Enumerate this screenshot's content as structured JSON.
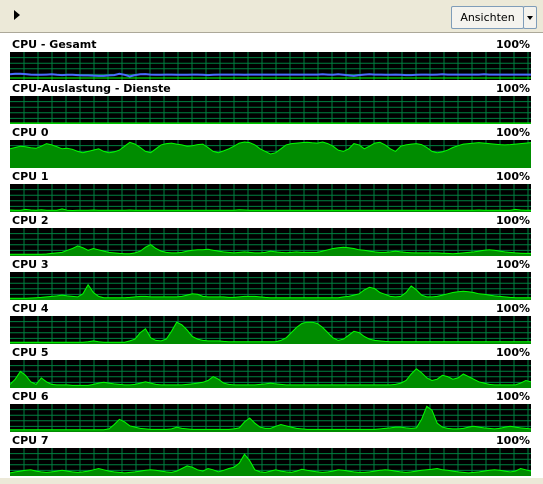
{
  "toolbar": {
    "views_label": "Ansichten"
  },
  "colors": {
    "graph_background": "#000000",
    "grid": "#008040",
    "line": "#00ff00",
    "fill": "#008c00",
    "total_line": "#4a6bff"
  },
  "scale_max_label": "100%",
  "graphs": [
    {
      "label": "CPU - Gesamt",
      "max_label": "100%",
      "values": [
        18,
        20,
        20,
        19,
        17,
        16,
        16,
        17,
        18,
        16,
        15,
        16,
        16,
        15,
        14,
        14,
        13,
        12,
        12,
        14,
        15,
        20,
        16,
        10,
        15,
        18,
        19,
        17,
        16,
        16,
        17,
        17,
        16,
        16,
        16,
        17,
        17,
        16,
        15,
        16,
        17,
        17,
        17,
        17,
        17,
        16,
        17,
        17,
        17,
        17,
        17,
        17,
        17,
        17,
        17,
        17,
        17,
        17,
        17,
        17,
        18,
        17,
        16,
        18,
        16,
        14,
        12,
        15,
        17,
        18,
        17,
        17,
        16,
        16,
        17,
        16,
        15,
        15,
        16,
        17,
        17,
        16,
        17,
        18,
        17,
        17,
        17,
        17,
        17,
        17,
        17,
        18,
        17,
        17,
        17,
        17,
        17,
        17,
        17,
        17,
        17
      ]
    },
    {
      "label": "CPU-Auslastung - Dienste",
      "max_label": "100%",
      "values": [
        0,
        0,
        0,
        0,
        0,
        0,
        0,
        0,
        0,
        0,
        0,
        0,
        0,
        0,
        0,
        0,
        0,
        0,
        0,
        0,
        0,
        0,
        0,
        0,
        0,
        0,
        0,
        0,
        0,
        0,
        0,
        0,
        0,
        0,
        0,
        0,
        0,
        0,
        0,
        0,
        0,
        0,
        0,
        0,
        0,
        0,
        0,
        0,
        0,
        0,
        0,
        0,
        0,
        0,
        0,
        0,
        0,
        0,
        0,
        0,
        0,
        0,
        0,
        0,
        0,
        0,
        0,
        0,
        0,
        0,
        0,
        0,
        0,
        0,
        0,
        0,
        0,
        0,
        0,
        0,
        0,
        0,
        0,
        0,
        0,
        0,
        0,
        0,
        0,
        0,
        0,
        0,
        0,
        0,
        0,
        0,
        0,
        0,
        0,
        0,
        0
      ]
    },
    {
      "label": "CPU 0",
      "max_label": "100%",
      "values": [
        70,
        75,
        80,
        78,
        74,
        72,
        80,
        90,
        85,
        78,
        70,
        72,
        68,
        60,
        55,
        60,
        65,
        70,
        60,
        55,
        58,
        65,
        80,
        95,
        88,
        75,
        60,
        55,
        70,
        85,
        90,
        92,
        88,
        85,
        80,
        82,
        86,
        88,
        75,
        60,
        55,
        62,
        70,
        80,
        92,
        96,
        94,
        85,
        70,
        60,
        50,
        55,
        70,
        85,
        90,
        92,
        94,
        95,
        93,
        92,
        96,
        90,
        80,
        65,
        60,
        70,
        90,
        85,
        70,
        80,
        92,
        95,
        85,
        70,
        60,
        80,
        85,
        88,
        90,
        86,
        75,
        60,
        55,
        58,
        65,
        75,
        82,
        88,
        90,
        92,
        94,
        92,
        90,
        88,
        86,
        85,
        86,
        88,
        90,
        92,
        94
      ]
    },
    {
      "label": "CPU 1",
      "max_label": "100%",
      "values": [
        4,
        3,
        3,
        6,
        4,
        3,
        5,
        3,
        3,
        3,
        8,
        3,
        2,
        3,
        3,
        3,
        4,
        3,
        3,
        3,
        3,
        3,
        3,
        4,
        3,
        3,
        3,
        3,
        3,
        3,
        3,
        3,
        3,
        3,
        3,
        3,
        3,
        3,
        3,
        3,
        3,
        3,
        3,
        3,
        5,
        4,
        3,
        3,
        3,
        3,
        3,
        3,
        3,
        3,
        3,
        3,
        3,
        3,
        3,
        3,
        3,
        3,
        3,
        3,
        3,
        3,
        3,
        3,
        3,
        3,
        3,
        3,
        3,
        3,
        3,
        3,
        3,
        3,
        3,
        3,
        3,
        3,
        3,
        3,
        3,
        3,
        3,
        3,
        3,
        3,
        4,
        3,
        3,
        3,
        3,
        3,
        3,
        6,
        4,
        3,
        3
      ]
    },
    {
      "label": "CPU 2",
      "max_label": "100%",
      "values": [
        3,
        3,
        3,
        3,
        3,
        3,
        3,
        4,
        6,
        8,
        10,
        18,
        25,
        35,
        28,
        18,
        25,
        20,
        15,
        10,
        8,
        6,
        5,
        5,
        8,
        15,
        30,
        40,
        25,
        15,
        10,
        8,
        8,
        10,
        15,
        18,
        20,
        20,
        22,
        18,
        15,
        12,
        10,
        8,
        10,
        12,
        10,
        8,
        8,
        10,
        15,
        12,
        10,
        9,
        10,
        12,
        10,
        10,
        10,
        10,
        15,
        20,
        25,
        28,
        30,
        28,
        25,
        20,
        18,
        15,
        12,
        10,
        10,
        12,
        15,
        12,
        10,
        9,
        8,
        8,
        8,
        8,
        8,
        7,
        6,
        5,
        6,
        8,
        10,
        12,
        15,
        18,
        20,
        18,
        15,
        12,
        10,
        8,
        7,
        6,
        6
      ]
    },
    {
      "label": "CPU 3",
      "max_label": "100%",
      "values": [
        3,
        3,
        3,
        3,
        4,
        5,
        6,
        8,
        10,
        12,
        15,
        12,
        10,
        8,
        20,
        55,
        25,
        10,
        5,
        5,
        5,
        5,
        5,
        6,
        8,
        10,
        10,
        8,
        8,
        8,
        8,
        8,
        8,
        10,
        15,
        20,
        18,
        10,
        8,
        8,
        8,
        8,
        6,
        6,
        8,
        10,
        10,
        10,
        8,
        6,
        5,
        5,
        5,
        5,
        5,
        5,
        5,
        5,
        5,
        5,
        5,
        5,
        5,
        5,
        8,
        10,
        15,
        20,
        35,
        45,
        40,
        25,
        18,
        10,
        8,
        10,
        25,
        50,
        35,
        15,
        8,
        8,
        10,
        15,
        20,
        25,
        28,
        30,
        28,
        25,
        20,
        18,
        15,
        12,
        10,
        8,
        6,
        5,
        5,
        5,
        5
      ]
    },
    {
      "label": "CPU 4",
      "max_label": "100%",
      "values": [
        3,
        3,
        3,
        3,
        3,
        3,
        3,
        3,
        3,
        3,
        3,
        3,
        3,
        3,
        3,
        5,
        8,
        5,
        3,
        3,
        3,
        3,
        3,
        8,
        15,
        40,
        55,
        20,
        10,
        8,
        15,
        45,
        80,
        70,
        50,
        25,
        15,
        10,
        8,
        8,
        8,
        6,
        5,
        5,
        5,
        5,
        5,
        5,
        5,
        5,
        5,
        5,
        10,
        20,
        40,
        60,
        75,
        80,
        80,
        75,
        60,
        40,
        20,
        10,
        15,
        30,
        45,
        40,
        25,
        15,
        10,
        8,
        6,
        5,
        5,
        5,
        5,
        5,
        5,
        5,
        5,
        5,
        5,
        5,
        5,
        5,
        5,
        5,
        5,
        5,
        5,
        5,
        5,
        5,
        5,
        5,
        5,
        5,
        5,
        5,
        5
      ]
    },
    {
      "label": "CPU 5",
      "max_label": "100%",
      "values": [
        10,
        30,
        60,
        45,
        20,
        10,
        35,
        20,
        10,
        8,
        8,
        8,
        6,
        6,
        6,
        6,
        10,
        15,
        18,
        15,
        12,
        10,
        8,
        8,
        10,
        15,
        20,
        15,
        10,
        8,
        8,
        8,
        8,
        8,
        10,
        12,
        15,
        18,
        25,
        40,
        30,
        15,
        10,
        8,
        8,
        8,
        8,
        8,
        10,
        12,
        15,
        12,
        10,
        8,
        8,
        8,
        8,
        8,
        8,
        8,
        8,
        8,
        8,
        8,
        8,
        8,
        8,
        8,
        8,
        8,
        8,
        8,
        8,
        8,
        10,
        15,
        25,
        50,
        70,
        55,
        35,
        25,
        30,
        45,
        40,
        30,
        35,
        50,
        40,
        30,
        20,
        15,
        10,
        8,
        8,
        8,
        8,
        8,
        15,
        25,
        20
      ]
    },
    {
      "label": "CPU 6",
      "max_label": "100%",
      "values": [
        5,
        5,
        5,
        5,
        5,
        5,
        5,
        5,
        5,
        5,
        5,
        5,
        5,
        5,
        5,
        5,
        5,
        5,
        5,
        8,
        25,
        45,
        35,
        20,
        15,
        10,
        8,
        6,
        6,
        6,
        6,
        8,
        15,
        10,
        8,
        6,
        6,
        6,
        6,
        6,
        6,
        6,
        6,
        8,
        12,
        35,
        50,
        30,
        15,
        10,
        10,
        18,
        25,
        20,
        15,
        10,
        8,
        6,
        6,
        6,
        6,
        6,
        6,
        6,
        6,
        6,
        6,
        6,
        6,
        6,
        6,
        8,
        10,
        12,
        15,
        15,
        12,
        10,
        12,
        45,
        95,
        80,
        30,
        15,
        10,
        8,
        8,
        10,
        15,
        18,
        15,
        12,
        10,
        8,
        10,
        15,
        18,
        15,
        12,
        10,
        8
      ]
    },
    {
      "label": "CPU 7",
      "max_label": "100%",
      "values": [
        8,
        12,
        15,
        18,
        20,
        15,
        12,
        10,
        12,
        15,
        18,
        15,
        12,
        10,
        12,
        15,
        20,
        25,
        20,
        15,
        12,
        10,
        8,
        10,
        12,
        15,
        18,
        20,
        18,
        15,
        12,
        10,
        15,
        25,
        35,
        30,
        20,
        15,
        25,
        20,
        12,
        18,
        25,
        30,
        45,
        80,
        55,
        20,
        12,
        10,
        15,
        20,
        15,
        12,
        10,
        15,
        22,
        18,
        15,
        12,
        10,
        12,
        15,
        20,
        18,
        15,
        12,
        10,
        10,
        12,
        15,
        18,
        20,
        18,
        15,
        12,
        10,
        12,
        15,
        18,
        20,
        22,
        25,
        20,
        18,
        15,
        12,
        10,
        8,
        10,
        12,
        15,
        18,
        20,
        18,
        15,
        12,
        15,
        25,
        20,
        15
      ]
    }
  ]
}
